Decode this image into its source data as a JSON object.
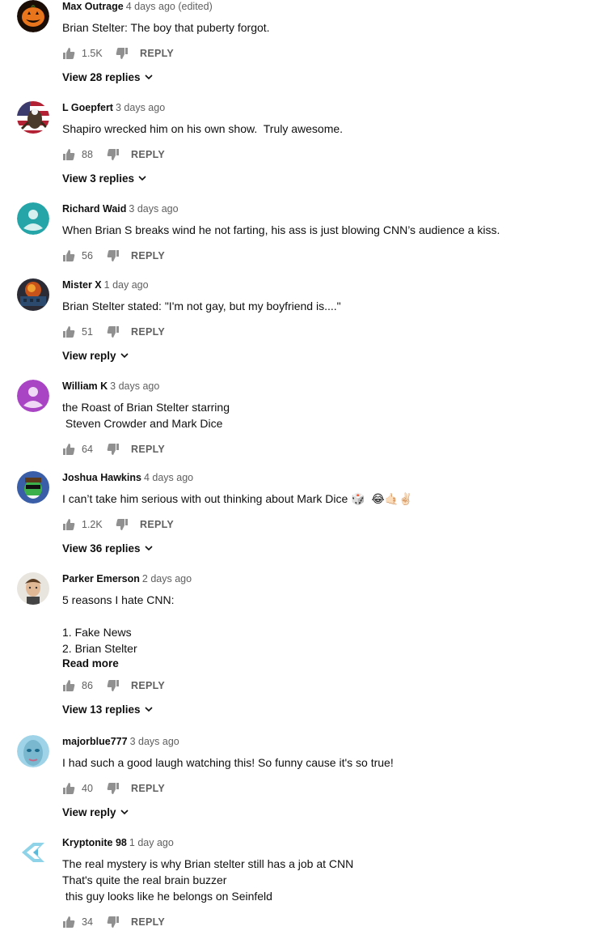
{
  "accent_color": "#606060",
  "reply_label": "REPLY",
  "comments": [
    {
      "author": "Max Outrage",
      "time": "4 days ago (edited)",
      "lines": [
        "Brian Stelter: The boy that puberty forgot."
      ],
      "likes": "1.5K",
      "view_replies": "View 28 replies",
      "avatar": "pumpkin"
    },
    {
      "author": "L Goepfert",
      "time": "3 days ago",
      "lines": [
        "Shapiro wrecked him on his own show.  Truly awesome."
      ],
      "likes": "88",
      "view_replies": "View 3 replies",
      "avatar": "flag-eagle"
    },
    {
      "author": "Richard Waid",
      "time": "3 days ago",
      "lines": [
        "When Brian S breaks wind he not farting, his ass is just blowing CNN’s audience a kiss."
      ],
      "likes": "56",
      "avatar": "default-teal"
    },
    {
      "author": "Mister X",
      "time": "1 day ago",
      "lines": [
        "Brian Stelter stated: \"I'm not gay, but my boyfriend is....\""
      ],
      "likes": "51",
      "view_replies": "View reply",
      "avatar": "fire-photo"
    },
    {
      "author": "William K",
      "time": "3 days ago",
      "lines": [
        "the Roast of Brian Stelter starring",
        " Steven Crowder and Mark Dice"
      ],
      "likes": "64",
      "avatar": "default-purple"
    },
    {
      "author": "Joshua Hawkins",
      "time": "4 days ago",
      "lines": [
        "I can’t take him serious with out thinking about Mark Dice 🎲  😂🤙🏻✌🏻"
      ],
      "likes": "1.2K",
      "view_replies": "View 36 replies",
      "avatar": "cartoon-frog"
    },
    {
      "author": "Parker Emerson",
      "time": "2 days ago",
      "lines": [
        "5 reasons I hate CNN:",
        "",
        "1. Fake News",
        "2. Brian Stelter"
      ],
      "read_more": "Read more",
      "likes": "86",
      "view_replies": "View 13 replies",
      "avatar": "face-photo"
    },
    {
      "author": "majorblue777",
      "time": "3 days ago",
      "lines": [
        "I had such a good laugh watching this! So funny cause it's so true!"
      ],
      "likes": "40",
      "view_replies": "View reply",
      "avatar": "blue-face"
    },
    {
      "author": "Kryptonite 98",
      "time": "1 day ago",
      "lines": [
        "The real mystery is why Brian stelter still has a job at CNN",
        "That's quite the real brain buzzer",
        " this guy looks like he belongs on Seinfeld"
      ],
      "likes": "34",
      "avatar": "logo-x"
    }
  ]
}
